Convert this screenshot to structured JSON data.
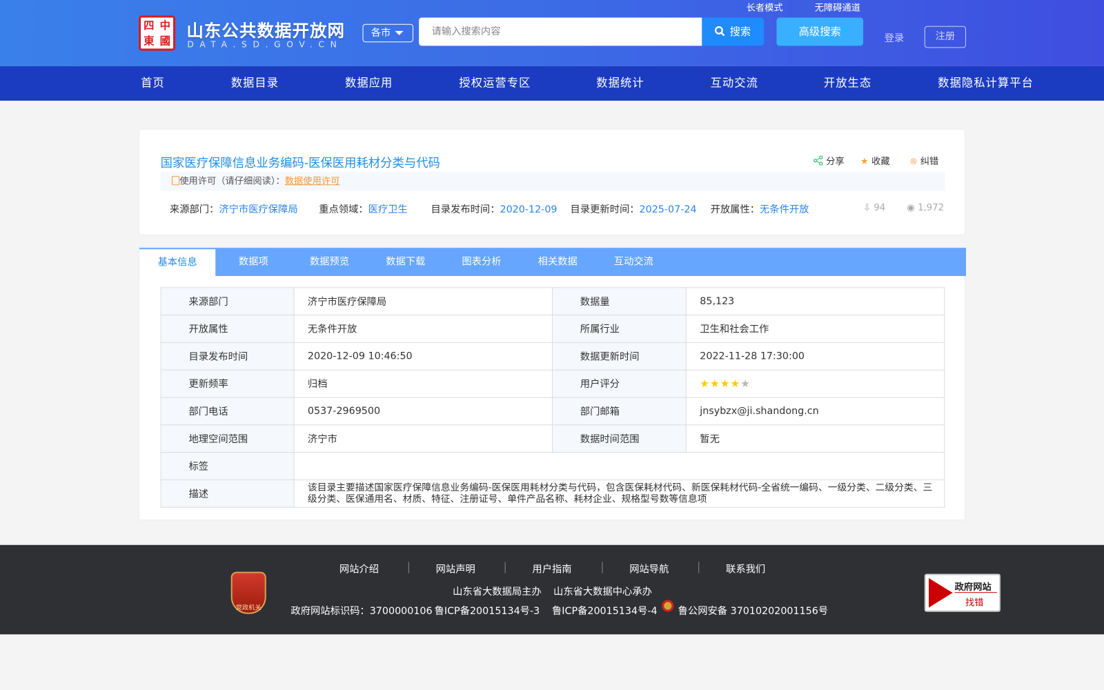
{
  "header": {
    "site_title": "山东公共数据开放网",
    "site_subtitle": "DATA.SD.GOV.CN",
    "logo_text": [
      "中",
      "四",
      "國",
      "東"
    ],
    "city_select": "各市",
    "search_placeholder": "请输入搜索内容",
    "search_button": "搜索",
    "advanced_search": "高级搜索",
    "login": "登录",
    "register": "注册",
    "elder_mode": "长者模式",
    "accessibility": "无障碍通道"
  },
  "nav": [
    "首页",
    "数据目录",
    "数据应用",
    "授权运营专区",
    "数据统计",
    "互动交流",
    "开放生态",
    "数据隐私计算平台"
  ],
  "dataset": {
    "title": "国家医疗保障信息业务编码-医保医用耗材分类与代码",
    "actions": {
      "share": "分享",
      "favorite": "收藏",
      "report": "纠错"
    },
    "license_label": "使用许可（请仔细阅读）：",
    "license_link": "数据使用许可",
    "meta": [
      {
        "k": "来源部门：",
        "v": "济宁市医疗保障局"
      },
      {
        "k": "重点领域：",
        "v": "医疗卫生"
      },
      {
        "k": "目录发布时间：",
        "v": "2020-12-09"
      },
      {
        "k": "目录更新时间：",
        "v": "2025-07-24"
      },
      {
        "k": "开放属性：",
        "v": "无条件开放"
      }
    ],
    "downloads": "94",
    "views": "1,972"
  },
  "tabs": [
    "基本信息",
    "数据项",
    "数据预览",
    "数据下载",
    "图表分析",
    "相关数据",
    "互动交流"
  ],
  "info": {
    "rows": [
      [
        "来源部门",
        "济宁市医疗保障局",
        "数据量",
        "85,123"
      ],
      [
        "开放属性",
        "无条件开放",
        "所属行业",
        "卫生和社会工作"
      ],
      [
        "目录发布时间",
        "2020-12-09 10:46:50",
        "数据更新时间",
        "2022-11-28 17:30:00"
      ],
      [
        "更新频率",
        "归档",
        "用户评分",
        ""
      ],
      [
        "部门电话",
        "0537-2969500",
        "部门邮箱",
        "jnsybzx@ji.shandong.cn"
      ],
      [
        "地理空间范围",
        "济宁市",
        "数据时间范围",
        "暂无"
      ]
    ],
    "rating": 4,
    "rating_max": 5,
    "tags_label": "标签",
    "tags": "",
    "desc_label": "描述",
    "desc": "该目录主要描述国家医疗保障信息业务编码-医保医用耗材分类与代码，包含医保耗材代码、新医保耗材代码-全省统一编码、一级分类、二级分类、三级分类、医保通用名、材质、特征、注册证号、单件产品名称、耗材企业、规格型号数等信息项"
  },
  "footer": {
    "links": [
      "网站介绍",
      "网站声明",
      "用户指南",
      "网站导航",
      "联系我们"
    ],
    "sponsor": "山东省大数据局主办",
    "organizer": "山东省大数据中心承办",
    "site_id": "政府网站标识码：3700000106",
    "icp1": "鲁ICP备20015134号-3",
    "icp2": "鲁ICP备20015134号-4",
    "police": "鲁公网安备 37010202001156号",
    "badge": "党政机关",
    "report_badge": "政府网站",
    "report_badge_sub": "找错"
  }
}
